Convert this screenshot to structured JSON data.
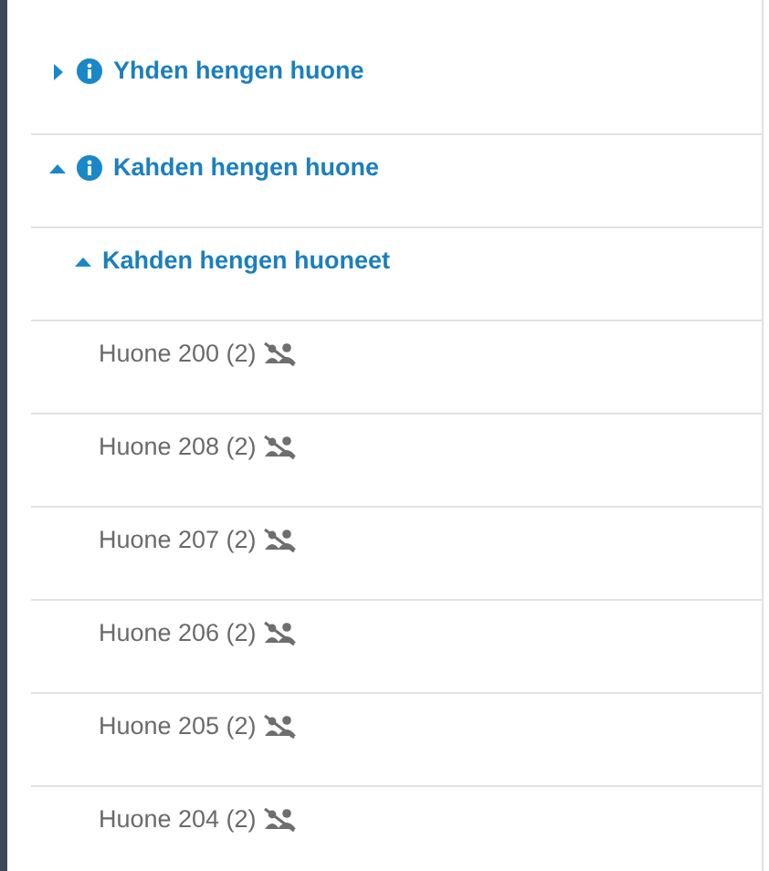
{
  "tree": [
    {
      "kind": "category",
      "label": "Yhden hengen huone",
      "expanded": false
    },
    {
      "kind": "category",
      "label": "Kahden hengen huone",
      "expanded": true,
      "children": [
        {
          "kind": "group",
          "label": "Kahden hengen huoneet",
          "expanded": true,
          "children": [
            {
              "kind": "room",
              "label": "Huone 200 (2)"
            },
            {
              "kind": "room",
              "label": "Huone 208 (2)"
            },
            {
              "kind": "room",
              "label": "Huone 207 (2)"
            },
            {
              "kind": "room",
              "label": "Huone 206 (2)"
            },
            {
              "kind": "room",
              "label": "Huone 205 (2)"
            },
            {
              "kind": "room",
              "label": "Huone 204 (2)"
            }
          ]
        }
      ]
    }
  ]
}
